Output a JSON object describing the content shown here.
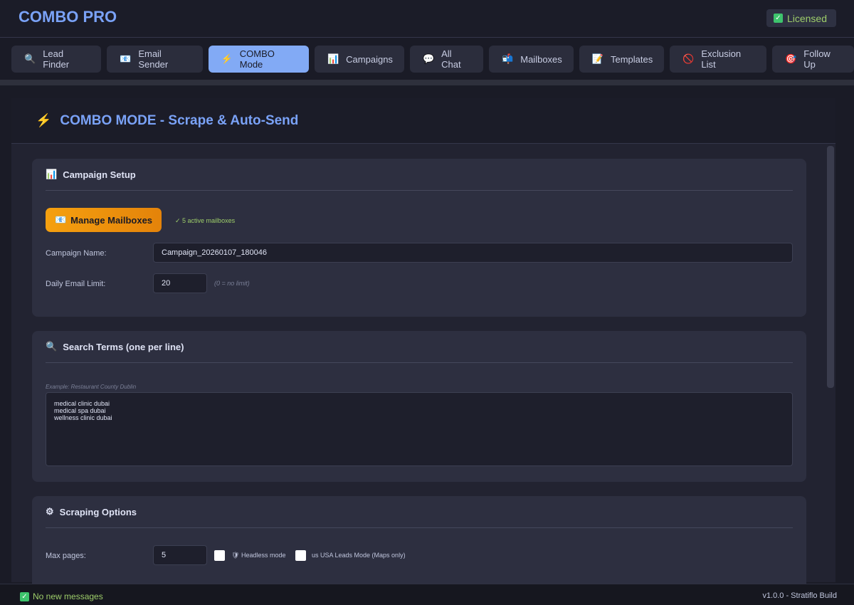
{
  "app": {
    "title": "COMBO PRO",
    "license": "Licensed"
  },
  "tabs": [
    {
      "label": "Lead Finder",
      "icon": "🔍"
    },
    {
      "label": "Email Sender",
      "icon": "📧"
    },
    {
      "label": "COMBO Mode",
      "icon": "⚡"
    },
    {
      "label": "Campaigns",
      "icon": "📊"
    },
    {
      "label": "All Chat",
      "icon": "💬"
    },
    {
      "label": "Mailboxes",
      "icon": "📬"
    },
    {
      "label": "Templates",
      "icon": "📝"
    },
    {
      "label": "Exclusion List",
      "icon": "🚫"
    },
    {
      "label": "Follow Up",
      "icon": "🎯"
    }
  ],
  "page": {
    "title": "COMBO MODE - Scrape & Auto-Send"
  },
  "setup": {
    "title": "Campaign Setup",
    "manage_btn": "Manage Mailboxes",
    "active": "✓ 5 active mailboxes",
    "campaign_label": "Campaign Name:",
    "campaign_value": "Campaign_20260107_180046",
    "limit_label": "Daily Email Limit:",
    "limit_value": "20",
    "limit_hint": "(0 = no limit)"
  },
  "search": {
    "title": "Search Terms (one per line)",
    "placeholder": "Example: Restaurant County Dublin",
    "value": "medical clinic dubai\nmedical spa dubai\nwellness clinic dubai"
  },
  "scraping": {
    "title": "Scraping Options",
    "max_label": "Max pages:",
    "max_value": "5",
    "headless": "Headless mode",
    "usa": "us USA Leads Mode (Maps only)"
  },
  "footer": {
    "status": "No new messages",
    "version": "v1.0.0 - Stratiflo Build"
  }
}
